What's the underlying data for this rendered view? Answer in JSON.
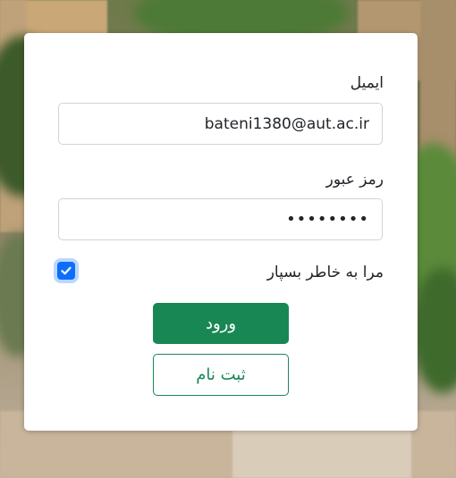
{
  "form": {
    "email_label": "ایمیل",
    "email_value": "bateni1380@aut.ac.ir",
    "password_label": "رمز عبور",
    "password_value": "••••••••",
    "remember_label": "مرا به خاطر بسپار",
    "remember_checked": true,
    "login_button": "ورود",
    "register_button": "ثبت نام"
  },
  "colors": {
    "primary_green": "#198754",
    "checkbox_blue": "#0d6efd"
  },
  "icons": {
    "checkbox_check": "check-icon"
  }
}
